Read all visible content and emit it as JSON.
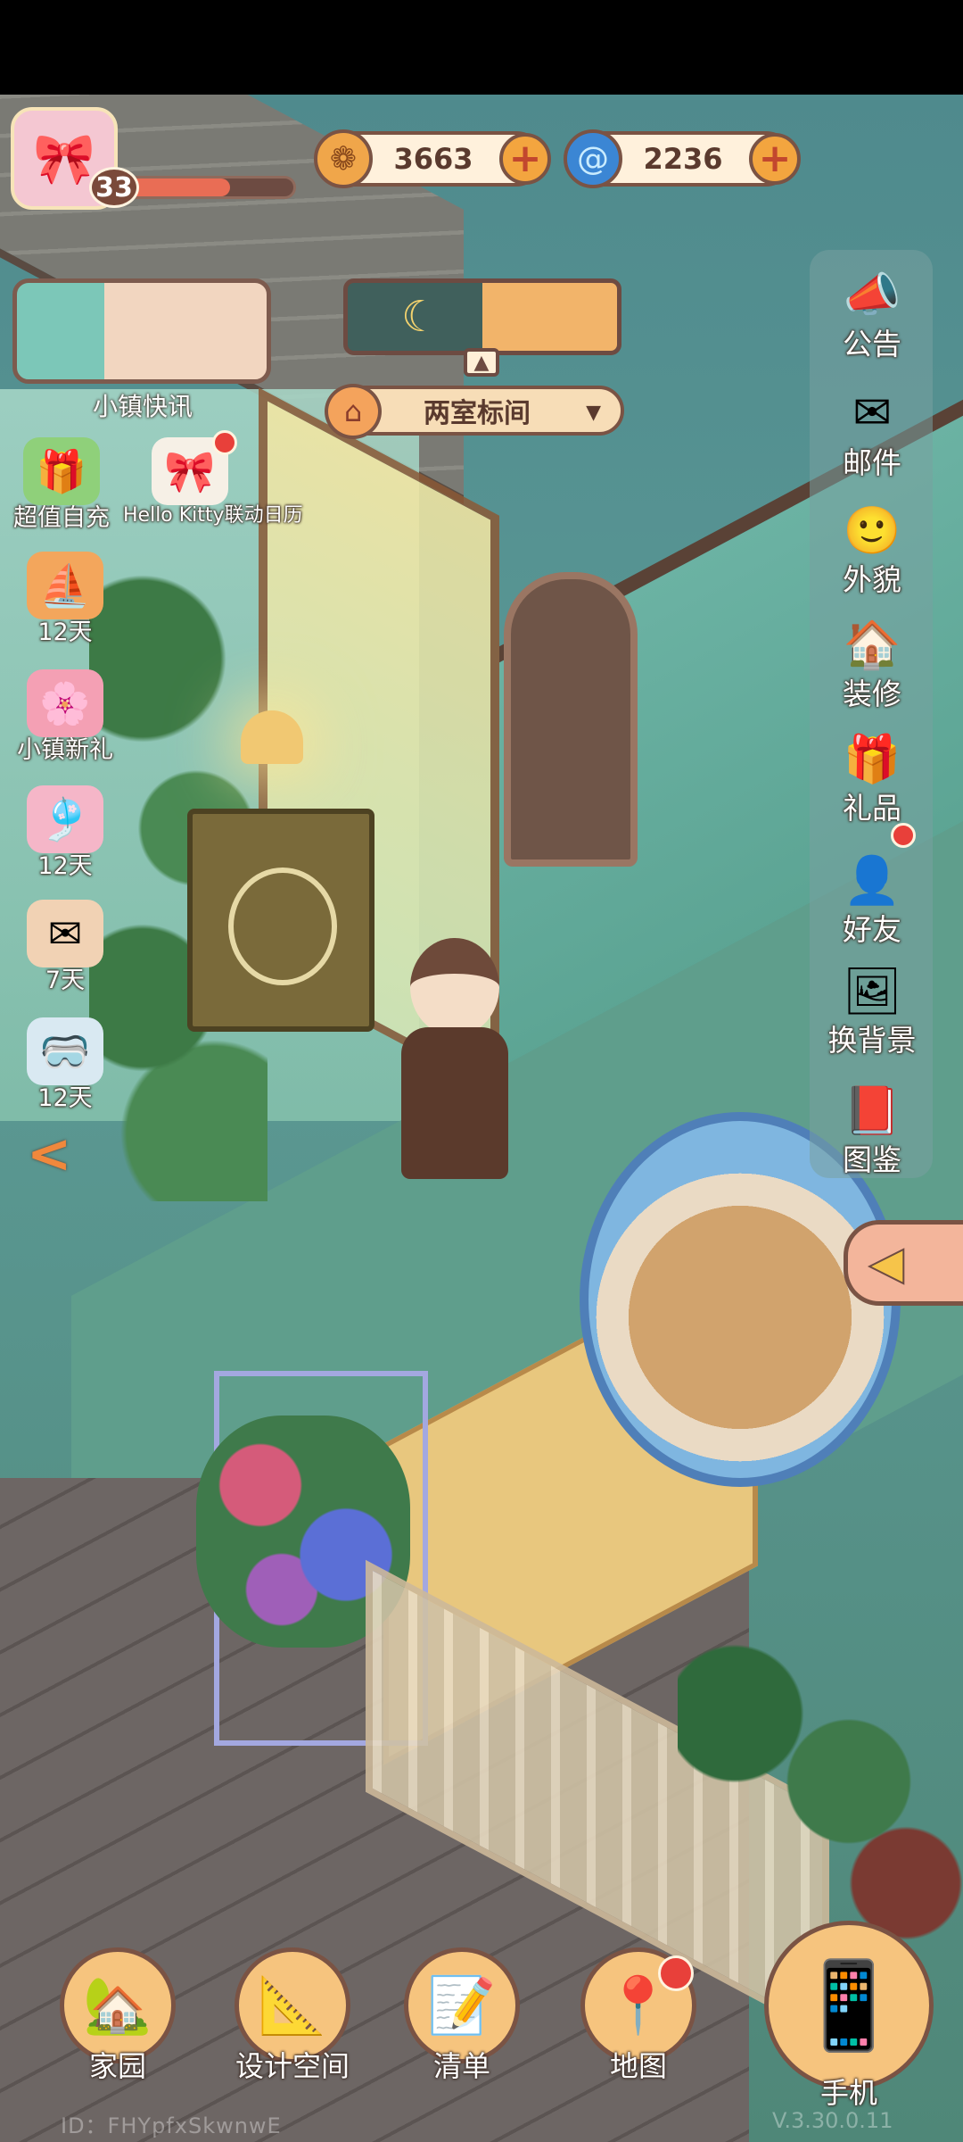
{
  "player": {
    "level": "33",
    "exp_fraction": 0.62,
    "avatar_icon": "hello-kitty-icon"
  },
  "currencies": [
    {
      "name": "coin",
      "icon": "coin-icon",
      "amount": "3663",
      "plus": "+"
    },
    {
      "name": "gem",
      "icon": "swirl-gem-icon",
      "amount": "2236",
      "plus": "+"
    }
  ],
  "news": {
    "label": "小镇快讯"
  },
  "weather": {
    "icon": "moon-icon",
    "glyph": "☾",
    "arrow": "▲"
  },
  "room": {
    "name": "两室标间",
    "caret": "▼",
    "house_glyph": "⌂"
  },
  "left_events": [
    {
      "label": "超值自充",
      "glyph": "🎁",
      "badge": false
    },
    {
      "label": "Hello Kitty联动日历",
      "glyph": "🎀",
      "badge": true
    },
    {
      "label": "12天",
      "glyph": "⛵",
      "badge": false
    },
    {
      "label": "小镇新礼",
      "glyph": "🌸",
      "badge": false
    },
    {
      "label": "12天",
      "glyph": "🎐",
      "badge": false
    },
    {
      "label": "7天",
      "glyph": "✉",
      "badge": false
    },
    {
      "label": "12天",
      "glyph": "🥽",
      "badge": false
    }
  ],
  "left_collapse": "<",
  "right_menu": [
    {
      "label": "公告",
      "icon": "megaphone-icon",
      "glyph": "📣",
      "badge": false
    },
    {
      "label": "邮件",
      "icon": "mail-icon",
      "glyph": "✉",
      "badge": false
    },
    {
      "label": "外貌",
      "icon": "face-icon",
      "glyph": "🙂",
      "badge": false
    },
    {
      "label": "装修",
      "icon": "house-wrench-icon",
      "glyph": "🏠",
      "badge": false
    },
    {
      "label": "礼品",
      "icon": "gift-icon",
      "glyph": "🎁",
      "badge": true
    },
    {
      "label": "好友",
      "icon": "friend-book-icon",
      "glyph": "👤",
      "badge": false
    },
    {
      "label": "换背景",
      "icon": "background-icon",
      "glyph": "🖼",
      "badge": false
    },
    {
      "label": "图鉴",
      "icon": "album-icon",
      "glyph": "📕",
      "badge": false
    }
  ],
  "right_collapse": "◀",
  "bottom_nav": [
    {
      "label": "家园",
      "icon": "home-icon",
      "glyph": "🏡",
      "badge": false
    },
    {
      "label": "设计空间",
      "icon": "design-space-icon",
      "glyph": "📐",
      "badge": false
    },
    {
      "label": "清单",
      "icon": "list-icon",
      "glyph": "📝",
      "badge": false
    },
    {
      "label": "地图",
      "icon": "map-pin-icon",
      "glyph": "📍",
      "badge": true
    },
    {
      "label": "手机",
      "icon": "phone-icon",
      "glyph": "📱",
      "badge": false
    }
  ],
  "footer": {
    "id": "ID：FHYpfxSkwnwE",
    "version": "V.3.30.0.11"
  }
}
